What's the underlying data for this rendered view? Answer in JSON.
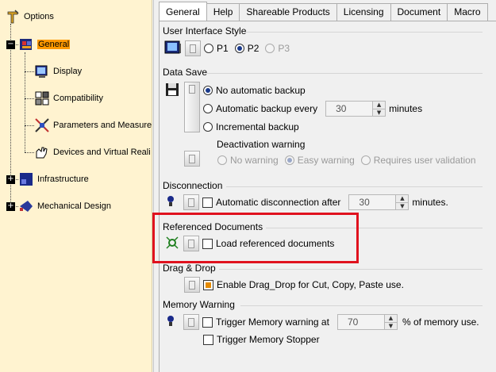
{
  "tree": {
    "items": [
      {
        "label": "Options"
      },
      {
        "label": "General"
      },
      {
        "label": "Display"
      },
      {
        "label": "Compatibility"
      },
      {
        "label": "Parameters and Measure"
      },
      {
        "label": "Devices and Virtual Reali"
      },
      {
        "label": "Infrastructure"
      },
      {
        "label": "Mechanical Design"
      }
    ],
    "expanders": {
      "general": "−",
      "infrastructure": "+",
      "mechanical": "+"
    }
  },
  "tabs": [
    "General",
    "Help",
    "Shareable Products",
    "Licensing",
    "Document",
    "Macro"
  ],
  "sections": {
    "ui_style": {
      "title": "User Interface Style",
      "options": [
        "P1",
        "P2",
        "P3"
      ],
      "selected": "P2"
    },
    "data_save": {
      "title": "Data Save",
      "no_backup": "No automatic backup",
      "auto_backup": "Automatic backup every",
      "auto_backup_value": "30",
      "auto_backup_unit": "minutes",
      "incremental": "Incremental backup",
      "deactivation_title": "Deactivation warning",
      "deact_options": [
        "No warning",
        "Easy warning",
        "Requires user validation"
      ],
      "deact_selected": "Easy warning"
    },
    "disconnection": {
      "title": "Disconnection",
      "label": "Automatic disconnection after",
      "value": "30",
      "unit": "minutes."
    },
    "referenced": {
      "title": "Referenced Documents",
      "label": "Load referenced documents"
    },
    "drag_drop": {
      "title": "Drag & Drop",
      "label": "Enable Drag_Drop for Cut, Copy, Paste use.",
      "checked": true
    },
    "memory": {
      "title": "Memory Warning",
      "trigger_label": "Trigger Memory warning at",
      "value": "70",
      "unit": "% of memory use.",
      "stopper_label": "Trigger Memory Stopper"
    }
  },
  "colors": {
    "highlight": "#e0121e",
    "tree_bg": "#fff3d0",
    "selected": "#ff9900"
  }
}
